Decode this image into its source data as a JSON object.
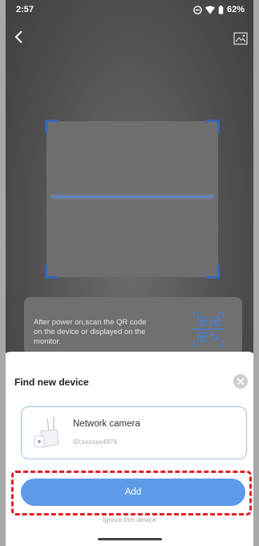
{
  "status_bar": {
    "time": "2:57",
    "battery": "62%"
  },
  "scanner": {
    "hint": "After power on,scan the QR code on the device or displayed on the monitor."
  },
  "sheet": {
    "title": "Find new device",
    "device": {
      "name": "Network camera",
      "id": "ID:xxxxxx4874"
    },
    "add_label": "Add",
    "ignore_label": "Ignore this device"
  },
  "colors": {
    "accent": "#5d9be8",
    "highlight": "#e0202a",
    "scan_corner": "#3566b8"
  }
}
